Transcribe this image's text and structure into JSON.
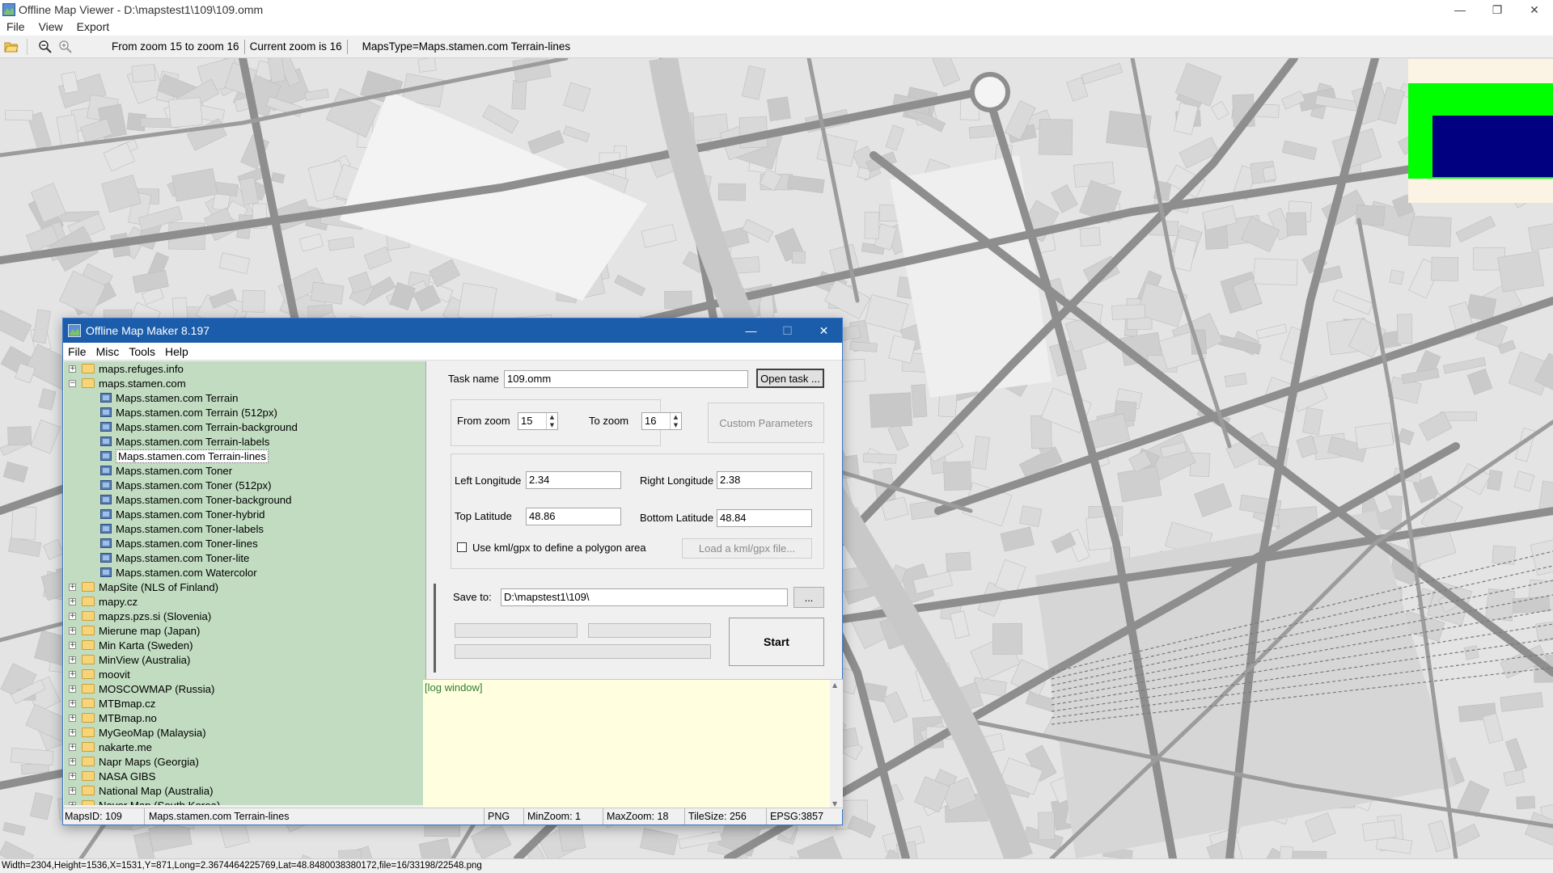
{
  "window": {
    "title": "Offline Map Viewer - D:\\mapstest1\\109\\109.omm",
    "controls": [
      "—",
      "❐",
      "✕"
    ]
  },
  "menu": [
    "File",
    "View",
    "Export"
  ],
  "toolbar": {
    "zoom_range": "From zoom 15 to zoom 16",
    "current_zoom": "Current zoom is 16",
    "maps_type": "MapsType=Maps.stamen.com Terrain-lines"
  },
  "statusbar": "Width=2304,Height=1536,X=1531,Y=871,Long=2.3674464225769,Lat=48.8480038380172,file=16/33198/22548.png",
  "colors": {
    "dialog_title": "#1c5dab",
    "tree_bg": "#c1dcc1",
    "log_bg": "#ffffe0",
    "minimap_frame": "#00ff00",
    "minimap_view": "#000080"
  },
  "dialog": {
    "title": "Offline Map Maker 8.197",
    "menu": [
      "File",
      "Misc",
      "Tools",
      "Help"
    ],
    "tree": [
      {
        "type": "folder",
        "expander": "+",
        "label": "maps.refuges.info"
      },
      {
        "type": "folder",
        "expander": "−",
        "label": "maps.stamen.com",
        "open": true
      },
      {
        "type": "map",
        "label": "Maps.stamen.com Terrain"
      },
      {
        "type": "map",
        "label": "Maps.stamen.com Terrain (512px)"
      },
      {
        "type": "map",
        "label": "Maps.stamen.com Terrain-background"
      },
      {
        "type": "map",
        "label": "Maps.stamen.com Terrain-labels"
      },
      {
        "type": "map",
        "label": "Maps.stamen.com Terrain-lines",
        "selected": true
      },
      {
        "type": "map",
        "label": "Maps.stamen.com Toner"
      },
      {
        "type": "map",
        "label": "Maps.stamen.com Toner (512px)"
      },
      {
        "type": "map",
        "label": "Maps.stamen.com Toner-background"
      },
      {
        "type": "map",
        "label": "Maps.stamen.com Toner-hybrid"
      },
      {
        "type": "map",
        "label": "Maps.stamen.com Toner-labels"
      },
      {
        "type": "map",
        "label": "Maps.stamen.com Toner-lines"
      },
      {
        "type": "map",
        "label": "Maps.stamen.com Toner-lite"
      },
      {
        "type": "map",
        "label": "Maps.stamen.com Watercolor"
      },
      {
        "type": "folder",
        "expander": "+",
        "label": "MapSite (NLS of Finland)"
      },
      {
        "type": "folder",
        "expander": "+",
        "label": "mapy.cz"
      },
      {
        "type": "folder",
        "expander": "+",
        "label": "mapzs.pzs.si (Slovenia)"
      },
      {
        "type": "folder",
        "expander": "+",
        "label": "Mierune map (Japan)"
      },
      {
        "type": "folder",
        "expander": "+",
        "label": "Min Karta (Sweden)"
      },
      {
        "type": "folder",
        "expander": "+",
        "label": "MinView (Australia)"
      },
      {
        "type": "folder",
        "expander": "+",
        "label": "moovit"
      },
      {
        "type": "folder",
        "expander": "+",
        "label": "MOSCOWMAP (Russia)"
      },
      {
        "type": "folder",
        "expander": "+",
        "label": "MTBmap.cz"
      },
      {
        "type": "folder",
        "expander": "+",
        "label": "MTBmap.no"
      },
      {
        "type": "folder",
        "expander": "+",
        "label": "MyGeoMap (Malaysia)"
      },
      {
        "type": "folder",
        "expander": "+",
        "label": "nakarte.me"
      },
      {
        "type": "folder",
        "expander": "+",
        "label": "Napr Maps (Georgia)"
      },
      {
        "type": "folder",
        "expander": "+",
        "label": "NASA GIBS"
      },
      {
        "type": "folder",
        "expander": "+",
        "label": "National Map (Australia)"
      },
      {
        "type": "folder",
        "expander": "+",
        "label": "Naver Map (South Korea)"
      }
    ],
    "task_name_label": "Task name",
    "task_name_value": "109.omm",
    "open_task_button": "Open task ...",
    "from_zoom_label": "From zoom",
    "from_zoom_value": "15",
    "to_zoom_label": "To zoom",
    "to_zoom_value": "16",
    "custom_params_button": "Custom Parameters",
    "left_lon_label": "Left Longitude",
    "left_lon_value": "2.34",
    "right_lon_label": "Right Longitude",
    "right_lon_value": "2.38",
    "top_lat_label": "Top Latitude",
    "top_lat_value": "48.86",
    "bottom_lat_label": "Bottom Latitude",
    "bottom_lat_value": "48.84",
    "kml_checkbox_label": "Use kml/gpx to define a polygon area",
    "load_kml_button": "Load a kml/gpx file...",
    "save_to_label": "Save to:",
    "save_to_value": "D:\\mapstest1\\109\\",
    "browse_button": "...",
    "start_button": "Start",
    "log_text": "[log window]",
    "status": {
      "maps_id": "MapsID: 109",
      "maps_name": "Maps.stamen.com Terrain-lines",
      "format": "PNG",
      "min_zoom": "MinZoom: 1",
      "max_zoom": "MaxZoom: 18",
      "tile_size": "TileSize: 256",
      "epsg": "EPSG:3857"
    }
  }
}
